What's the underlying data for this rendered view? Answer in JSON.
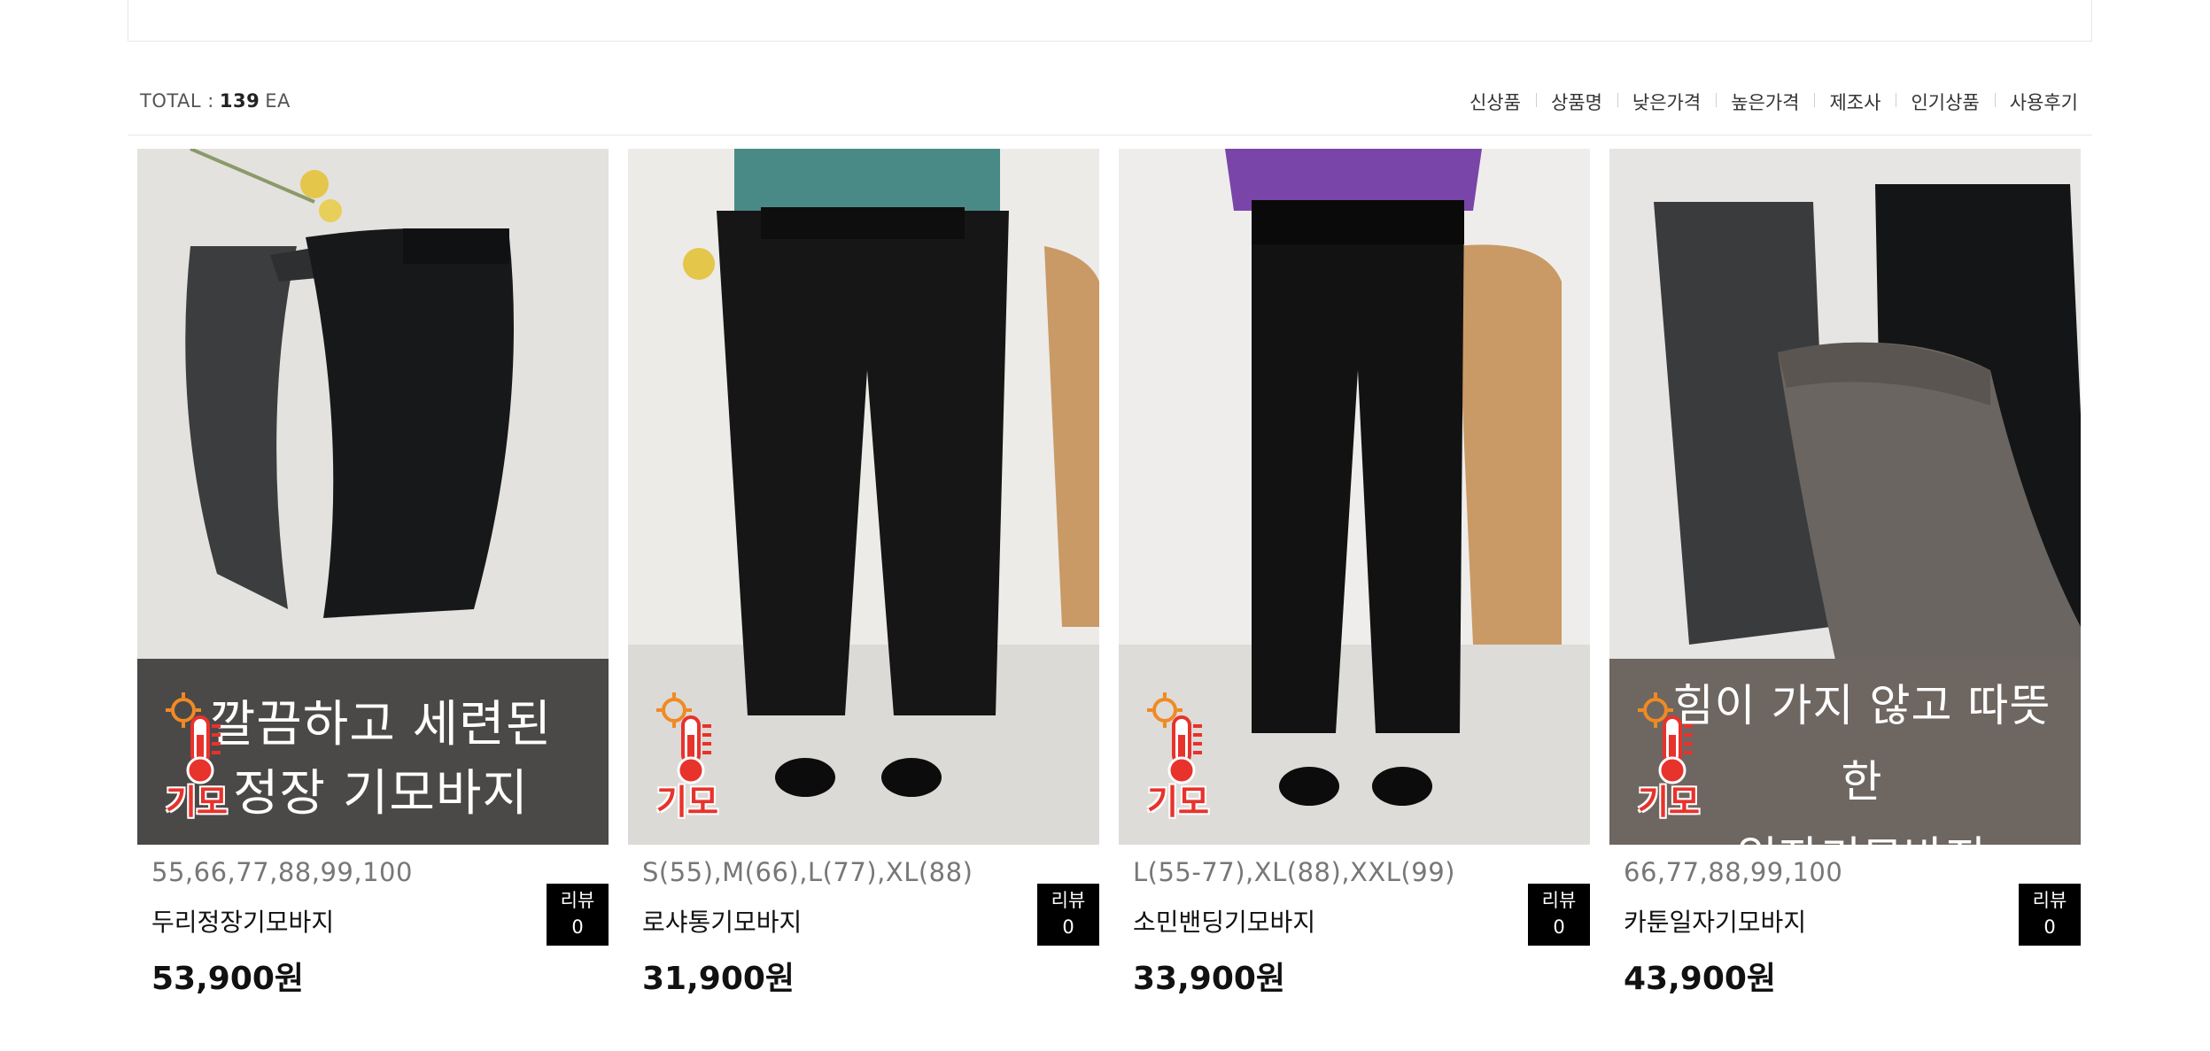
{
  "total": {
    "prefix": "TOTAL :",
    "count": "139",
    "unit": "EA"
  },
  "sort_options": [
    "신상품",
    "상품명",
    "낮은가격",
    "높은가격",
    "제조사",
    "인기상품",
    "사용후기"
  ],
  "products": [
    {
      "banner_line1": "깔끔하고 세련된",
      "banner_line2": "정장 기모바지",
      "badge": "기모",
      "sizes": "55,66,77,88,99,100",
      "name": "두리정장기모바지",
      "price": "53,900원",
      "review_label": "리뷰",
      "review_count": "0"
    },
    {
      "badge": "기모",
      "sizes": "S(55),M(66),L(77),XL(88)",
      "name": "로샤통기모바지",
      "price": "31,900원",
      "review_label": "리뷰",
      "review_count": "0"
    },
    {
      "badge": "기모",
      "sizes": "L(55-77),XL(88),XXL(99)",
      "name": "소민밴딩기모바지",
      "price": "33,900원",
      "review_label": "리뷰",
      "review_count": "0"
    },
    {
      "banner_line1": "힘이 가지 않고 따뜻한",
      "banner_line2": "일자기모바지",
      "badge": "기모",
      "sizes": "66,77,88,99,100",
      "name": "카툰일자기모바지",
      "price": "43,900원",
      "review_label": "리뷰",
      "review_count": "0"
    }
  ],
  "colors": {
    "badge_red": "#e8322c",
    "review_bg": "#000000",
    "banner_dark": "#4a4948",
    "banner_taupe": "#6e6661"
  }
}
